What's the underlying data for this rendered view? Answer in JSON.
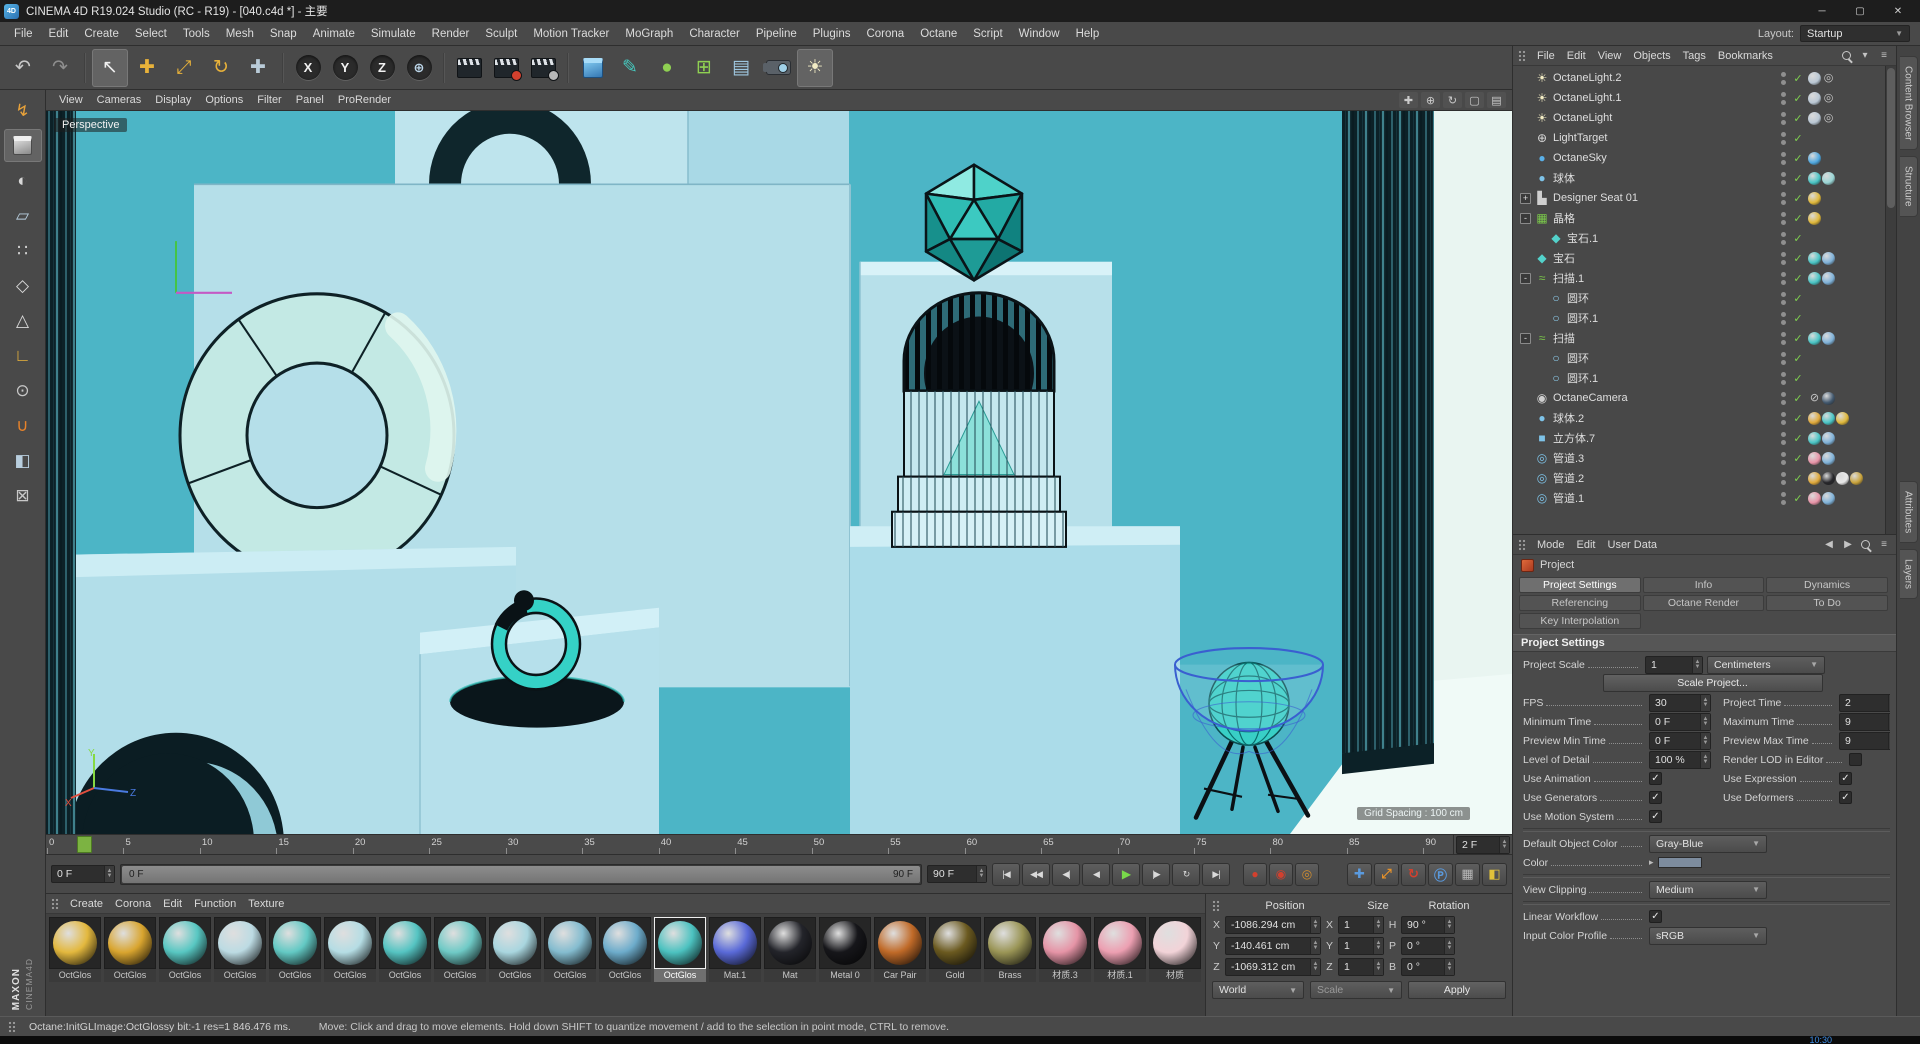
{
  "titlebar": {
    "app_icon": "4D",
    "title": "CINEMA 4D R19.024 Studio (RC - R19) - [040.c4d *] - 主要",
    "window_buttons": {
      "minimize": "─",
      "restore": "▢",
      "close": "✕"
    }
  },
  "menubar": {
    "items": [
      "File",
      "Edit",
      "Create",
      "Select",
      "Tools",
      "Mesh",
      "Snap",
      "Animate",
      "Simulate",
      "Render",
      "Sculpt",
      "Motion Tracker",
      "MoGraph",
      "Character",
      "Pipeline",
      "Plugins",
      "Corona",
      "Octane",
      "Script",
      "Window",
      "Help"
    ],
    "layout_label": "Layout:",
    "layout_value": "Startup"
  },
  "main_toolbar": [
    {
      "name": "undo",
      "glyph": "↶",
      "color": "#c9c9c9"
    },
    {
      "name": "redo",
      "glyph": "↷",
      "color": "#8e8e8e"
    },
    {
      "name": "separator"
    },
    {
      "name": "live-selection",
      "glyph": "↖",
      "color": "#f0f0f0",
      "active": true
    },
    {
      "name": "move",
      "glyph": "✚",
      "color": "#e8b23a"
    },
    {
      "name": "scale",
      "glyph": "⤢",
      "color": "#e8b23a"
    },
    {
      "name": "rotate",
      "glyph": "↻",
      "color": "#e8b23a"
    },
    {
      "name": "last-used-tool",
      "glyph": "✚",
      "color": "#b9cbd8"
    },
    {
      "name": "separator"
    },
    {
      "name": "lock-x-axis",
      "glyph": "X",
      "color": "#f2f2f2",
      "circled": true
    },
    {
      "name": "lock-y-axis",
      "glyph": "Y",
      "color": "#f2f2f2",
      "circled": true
    },
    {
      "name": "lock-z-axis",
      "glyph": "Z",
      "color": "#f2f2f2",
      "circled": true
    },
    {
      "name": "coordinate-system",
      "glyph": "⊕",
      "color": "#bdd7ea",
      "circled": true
    },
    {
      "name": "separator"
    },
    {
      "name": "render-view",
      "type": "clapper"
    },
    {
      "name": "render-to-picture-viewer",
      "type": "clapper",
      "badge": "#d2402e"
    },
    {
      "name": "edit-render-settings",
      "type": "clapper",
      "badge": "#b8b8b8"
    },
    {
      "name": "separator"
    },
    {
      "name": "add-cube-object",
      "type": "cube"
    },
    {
      "name": "add-spline",
      "glyph": "✎",
      "color": "#46c8be"
    },
    {
      "name": "add-subdivision-surface",
      "glyph": "●",
      "color": "#8fd052"
    },
    {
      "name": "add-mograph-cloner",
      "glyph": "⊞",
      "color": "#8fd052"
    },
    {
      "name": "add-environment",
      "glyph": "▤",
      "color": "#9ec7e0"
    },
    {
      "name": "add-camera",
      "type": "camera"
    },
    {
      "name": "add-light",
      "glyph": "☀",
      "color": "#f2ecc4",
      "active": true
    }
  ],
  "left_toolbar": [
    {
      "name": "make-editable",
      "glyph": "↯",
      "color": "#e8a23a"
    },
    {
      "name": "model-mode",
      "type": "cube",
      "active": true
    },
    {
      "name": "texture-mode",
      "glyph": "◐",
      "color": "#d8d8d8"
    },
    {
      "name": "workplane-mode",
      "glyph": "▱",
      "color": "#b8cede"
    },
    {
      "name": "points-mode",
      "glyph": "∷",
      "color": "#d8d8d8"
    },
    {
      "name": "edges-mode",
      "glyph": "◇",
      "color": "#d8d8d8"
    },
    {
      "name": "polygons-mode",
      "glyph": "△",
      "color": "#d8d8d8"
    },
    {
      "name": "enable-axis-mode",
      "glyph": "∟",
      "color": "#e8b23a"
    },
    {
      "name": "viewport-solo",
      "glyph": "⊙",
      "color": "#c8c8c8"
    },
    {
      "name": "enable-snap",
      "glyph": "∪",
      "color": "#e8832a"
    },
    {
      "name": "workplane-snap",
      "glyph": "◧",
      "color": "#b8cede"
    },
    {
      "name": "lock-workplane",
      "glyph": "⊠",
      "color": "#c8c8c8"
    }
  ],
  "viewport": {
    "menu": [
      "View",
      "Cameras",
      "Display",
      "Options",
      "Filter",
      "Panel",
      "ProRender"
    ],
    "nav": [
      {
        "name": "pan-view",
        "glyph": "✚"
      },
      {
        "name": "zoom-view",
        "glyph": "⊕"
      },
      {
        "name": "rotate-view",
        "glyph": "↻"
      },
      {
        "name": "toggle-view",
        "glyph": "▢"
      },
      {
        "name": "panel-menu",
        "glyph": "▤"
      }
    ],
    "camera_label": "Perspective",
    "grid_label": "Grid Spacing : 100 cm",
    "axis": {
      "x": "X",
      "y": "Y",
      "z": "Z"
    }
  },
  "object_manager": {
    "menu": [
      "File",
      "Edit",
      "View",
      "Objects",
      "Tags",
      "Bookmarks"
    ],
    "objects": [
      {
        "label": "OctaneLight.2",
        "icon": "light-icon",
        "glyph": "☀",
        "color": "#f2ecc4",
        "tags": [
          "#b9c7d4",
          "g:◎"
        ]
      },
      {
        "label": "OctaneLight.1",
        "icon": "light-icon",
        "glyph": "☀",
        "color": "#f2ecc4",
        "tags": [
          "#b9c7d4",
          "g:◎"
        ]
      },
      {
        "label": "OctaneLight",
        "icon": "light-icon",
        "glyph": "☀",
        "color": "#f2ecc4",
        "tags": [
          "#b9c7d4",
          "g:◎"
        ]
      },
      {
        "label": "LightTarget",
        "icon": "target-icon",
        "glyph": "⊕",
        "color": "#d8d8d8",
        "tags": []
      },
      {
        "label": "OctaneSky",
        "icon": "sky-icon",
        "glyph": "●",
        "color": "#5ab0e8",
        "tags": [
          "#4fa8e0"
        ]
      },
      {
        "label": "球体",
        "icon": "sphere-icon",
        "glyph": "●",
        "color": "#7ec3e8",
        "tags": [
          "#49c5c5",
          "#9ad6d6"
        ]
      },
      {
        "label": "Designer Seat 01",
        "icon": "model-icon",
        "glyph": "▙",
        "color": "#cfcfcf",
        "expand": "+",
        "tags": [
          "#e0b83a"
        ]
      },
      {
        "label": "晶格",
        "icon": "lattice-icon",
        "glyph": "▦",
        "color": "#7ac84a",
        "expand": "-",
        "tags": [
          "#e0b83a"
        ]
      },
      {
        "label": "宝石.1",
        "depth": 1,
        "icon": "gem-icon",
        "glyph": "◆",
        "color": "#53d2cb",
        "tags": []
      },
      {
        "label": "宝石",
        "icon": "gem-icon",
        "glyph": "◆",
        "color": "#53d2cb",
        "tags": [
          "#49c5c5",
          "#7fb2d9"
        ]
      },
      {
        "label": "扫描.1",
        "icon": "sweep-icon",
        "glyph": "≈",
        "color": "#7ac84a",
        "expand": "-",
        "tags": [
          "#49c5c5",
          "#7fb2d9"
        ]
      },
      {
        "label": "圆环",
        "depth": 1,
        "icon": "circle-spline-icon",
        "glyph": "○",
        "color": "#8fd0f0",
        "tags": []
      },
      {
        "label": "圆环.1",
        "depth": 1,
        "icon": "circle-spline-icon",
        "glyph": "○",
        "color": "#8fd0f0",
        "tags": []
      },
      {
        "label": "扫描",
        "icon": "sweep-icon",
        "glyph": "≈",
        "color": "#7ac84a",
        "expand": "-",
        "tags": [
          "#49c5c5",
          "#7fb2d9"
        ]
      },
      {
        "label": "圆环",
        "depth": 1,
        "icon": "circle-spline-icon",
        "glyph": "○",
        "color": "#8fd0f0",
        "tags": []
      },
      {
        "label": "圆环.1",
        "depth": 1,
        "icon": "circle-spline-icon",
        "glyph": "○",
        "color": "#8fd0f0",
        "tags": []
      },
      {
        "label": "OctaneCamera",
        "icon": "camera-icon",
        "glyph": "◉",
        "color": "#cfcfcf",
        "tags": [
          "g:⊘",
          "#42586e"
        ]
      },
      {
        "label": "球体.2",
        "icon": "sphere-icon",
        "glyph": "●",
        "color": "#7ec3e8",
        "tags": [
          "#e0a93a",
          "#49c5c5",
          "#e0b83a"
        ]
      },
      {
        "label": "立方体.7",
        "icon": "cube-icon",
        "glyph": "■",
        "color": "#7ec3e8",
        "tags": [
          "#49c5c5",
          "#7fb2d9"
        ]
      },
      {
        "label": "管道.3",
        "icon": "tube-icon",
        "glyph": "◎",
        "color": "#7ec3e8",
        "tags": [
          "#e894a8",
          "#7fb2d9"
        ]
      },
      {
        "label": "管道.2",
        "icon": "tube-icon",
        "glyph": "◎",
        "color": "#7ec3e8",
        "tags": [
          "#e0a93a",
          "#26262a",
          "#e8e8e8",
          "#c8a23a"
        ]
      },
      {
        "label": "管道.1",
        "icon": "tube-icon",
        "glyph": "◎",
        "color": "#7ec3e8",
        "tags": [
          "#e894a8",
          "#7fb2d9"
        ]
      }
    ]
  },
  "attributes": {
    "menu": [
      "Mode",
      "Edit",
      "User Data"
    ],
    "object": {
      "label": "Project"
    },
    "tabs": [
      {
        "label": "Project Settings",
        "active": true
      },
      {
        "label": "Info"
      },
      {
        "label": "Dynamics"
      },
      {
        "label": "Referencing"
      },
      {
        "label": "Octane Render"
      },
      {
        "label": "To Do"
      },
      {
        "label": "Key Interpolation"
      }
    ],
    "section": "Project Settings",
    "rows": [
      {
        "type": "scale",
        "label": "Project Scale",
        "value": "1",
        "unit": "Centimeters"
      },
      {
        "type": "button",
        "label": "Scale Project..."
      },
      {
        "type": "pair-field",
        "left": {
          "label": "FPS",
          "value": "30"
        },
        "right": {
          "label": "Project Time",
          "value": "2"
        }
      },
      {
        "type": "pair-field",
        "left": {
          "label": "Minimum Time",
          "value": "0 F"
        },
        "right": {
          "label": "Maximum Time",
          "value": "9"
        }
      },
      {
        "type": "pair-field",
        "left": {
          "label": "Preview Min Time",
          "value": "0 F"
        },
        "right": {
          "label": "Preview Max Time",
          "value": "9"
        }
      },
      {
        "type": "pair-mixed",
        "left": {
          "label": "Level of Detail",
          "value": "100 %"
        },
        "right": {
          "label": "Render LOD in Editor",
          "checked": false
        }
      },
      {
        "type": "pair-check",
        "left": {
          "label": "Use Animation",
          "checked": true
        },
        "right": {
          "label": "Use Expression",
          "checked": true
        }
      },
      {
        "type": "pair-check",
        "left": {
          "label": "Use Generators",
          "checked": true
        },
        "right": {
          "label": "Use Deformers",
          "checked": true
        }
      },
      {
        "type": "check",
        "label": "Use Motion System",
        "checked": true
      },
      {
        "type": "divider"
      },
      {
        "type": "dropdown",
        "label": "Default Object Color",
        "value": "Gray-Blue"
      },
      {
        "type": "color",
        "label": "Color",
        "swatch": "#7d8c9e"
      },
      {
        "type": "divider"
      },
      {
        "type": "dropdown",
        "label": "View Clipping",
        "value": "Medium"
      },
      {
        "type": "divider"
      },
      {
        "type": "check",
        "label": "Linear Workflow",
        "checked": true
      },
      {
        "type": "dropdown",
        "label": "Input Color Profile",
        "value": "sRGB"
      }
    ]
  },
  "right_tabs": [
    "Content Browser",
    "Structure",
    "Attributes",
    "Layers"
  ],
  "timeline": {
    "ticks": [
      "0",
      "5",
      "10",
      "15",
      "20",
      "25",
      "30",
      "35",
      "40",
      "45",
      "50",
      "55",
      "60",
      "65",
      "70",
      "75",
      "80",
      "85",
      "90"
    ],
    "max_frame": 92,
    "playhead_frame": 2,
    "current_frame": "2 F"
  },
  "anim": {
    "start_field": "0 F",
    "range_start": "0 F",
    "range_end": "90 F",
    "end_field": "90 F",
    "transport": [
      {
        "name": "goto-start",
        "glyph": "|◀"
      },
      {
        "name": "play-backwards",
        "glyph": "◀◀"
      },
      {
        "name": "previous-frame",
        "glyph": "◀|"
      },
      {
        "name": "previous-key",
        "glyph": "◀"
      },
      {
        "name": "play-forwards",
        "glyph": "▶",
        "accent": true
      },
      {
        "name": "next-frame",
        "glyph": "|▶"
      },
      {
        "name": "loop-playback",
        "glyph": "↻"
      },
      {
        "name": "goto-end",
        "glyph": "▶|"
      }
    ],
    "record": [
      {
        "name": "record-keyframe",
        "glyph": "●",
        "color": "#d2402e"
      },
      {
        "name": "autokeying",
        "glyph": "◉",
        "color": "#d2402e"
      },
      {
        "name": "keyframe-selection",
        "glyph": "◎",
        "color": "#d28e2e"
      }
    ],
    "toggles": [
      {
        "name": "record-position",
        "glyph": "✚",
        "color": "#5a9ade"
      },
      {
        "name": "record-scale",
        "glyph": "⤢",
        "color": "#e8932a"
      },
      {
        "name": "record-rotation",
        "glyph": "↻",
        "color": "#d2402e"
      },
      {
        "name": "record-parameter",
        "glyph": "Ⓟ",
        "color": "#5a9ade"
      },
      {
        "name": "record-point-level",
        "glyph": "▦",
        "color": "#b8b8b8"
      },
      {
        "name": "solo-animation",
        "glyph": "◧",
        "color": "#e0c23a"
      }
    ]
  },
  "materials": {
    "menu": [
      "Create",
      "Corona",
      "Edit",
      "Function",
      "Texture"
    ],
    "items": [
      {
        "label": "OctGlos",
        "color": "#e3b83e"
      },
      {
        "label": "OctGlos",
        "color": "#d9a52f"
      },
      {
        "label": "OctGlos",
        "color": "#58c7c2"
      },
      {
        "label": "OctGlos",
        "color": "#bcdbe3"
      },
      {
        "label": "OctGlos",
        "color": "#63c9c4"
      },
      {
        "label": "OctGlos",
        "color": "#b5dde4"
      },
      {
        "label": "OctGlos",
        "color": "#55c4c2"
      },
      {
        "label": "OctGlos",
        "color": "#6fcac6"
      },
      {
        "label": "OctGlos",
        "color": "#a9d6df"
      },
      {
        "label": "OctGlos",
        "color": "#84bccf"
      },
      {
        "label": "OctGlos",
        "color": "#6daccb"
      },
      {
        "label": "OctGlos",
        "color": "#4cc2c0",
        "selected": true
      },
      {
        "label": "Mat.1",
        "color": "#5a6ad8"
      },
      {
        "label": "Mat",
        "color": "#23242a"
      },
      {
        "label": "Metal 0",
        "color": "#16161a"
      },
      {
        "label": "Car Pair",
        "color": "#c06a28"
      },
      {
        "label": "Gold",
        "color": "#6b5a20"
      },
      {
        "label": "Brass",
        "color": "#9a9556"
      },
      {
        "label": "材质.3",
        "color": "#e594a6"
      },
      {
        "label": "材质.1",
        "color": "#ec9fb1"
      },
      {
        "label": "材质",
        "color": "#f2d3d8"
      }
    ]
  },
  "coordinates": {
    "headers": {
      "position": "Position",
      "size": "Size",
      "rotation": "Rotation"
    },
    "rows": [
      {
        "pl": "X",
        "pv": "-1086.294 cm",
        "sl": "X",
        "sv": "1",
        "rl": "H",
        "rv": "90 °"
      },
      {
        "pl": "Y",
        "pv": "-140.461 cm",
        "sl": "Y",
        "sv": "1",
        "rl": "P",
        "rv": "0 °"
      },
      {
        "pl": "Z",
        "pv": "-1069.312 cm",
        "sl": "Z",
        "sv": "1",
        "rl": "B",
        "rv": "0 °"
      }
    ],
    "mode": "World",
    "axis": "Scale",
    "apply": "Apply"
  },
  "status": {
    "left": "Octane:InitGLImage:OctGlossy  bit:-1 res=1  846.476 ms.",
    "hint": "Move: Click and drag to move elements. Hold down SHIFT to quantize movement / add to the selection in point mode, CTRL to remove."
  },
  "branding": {
    "maxon": "MAXON",
    "cinema": "CINEMA4D"
  },
  "taskstrip": {
    "clock": "10:30"
  }
}
